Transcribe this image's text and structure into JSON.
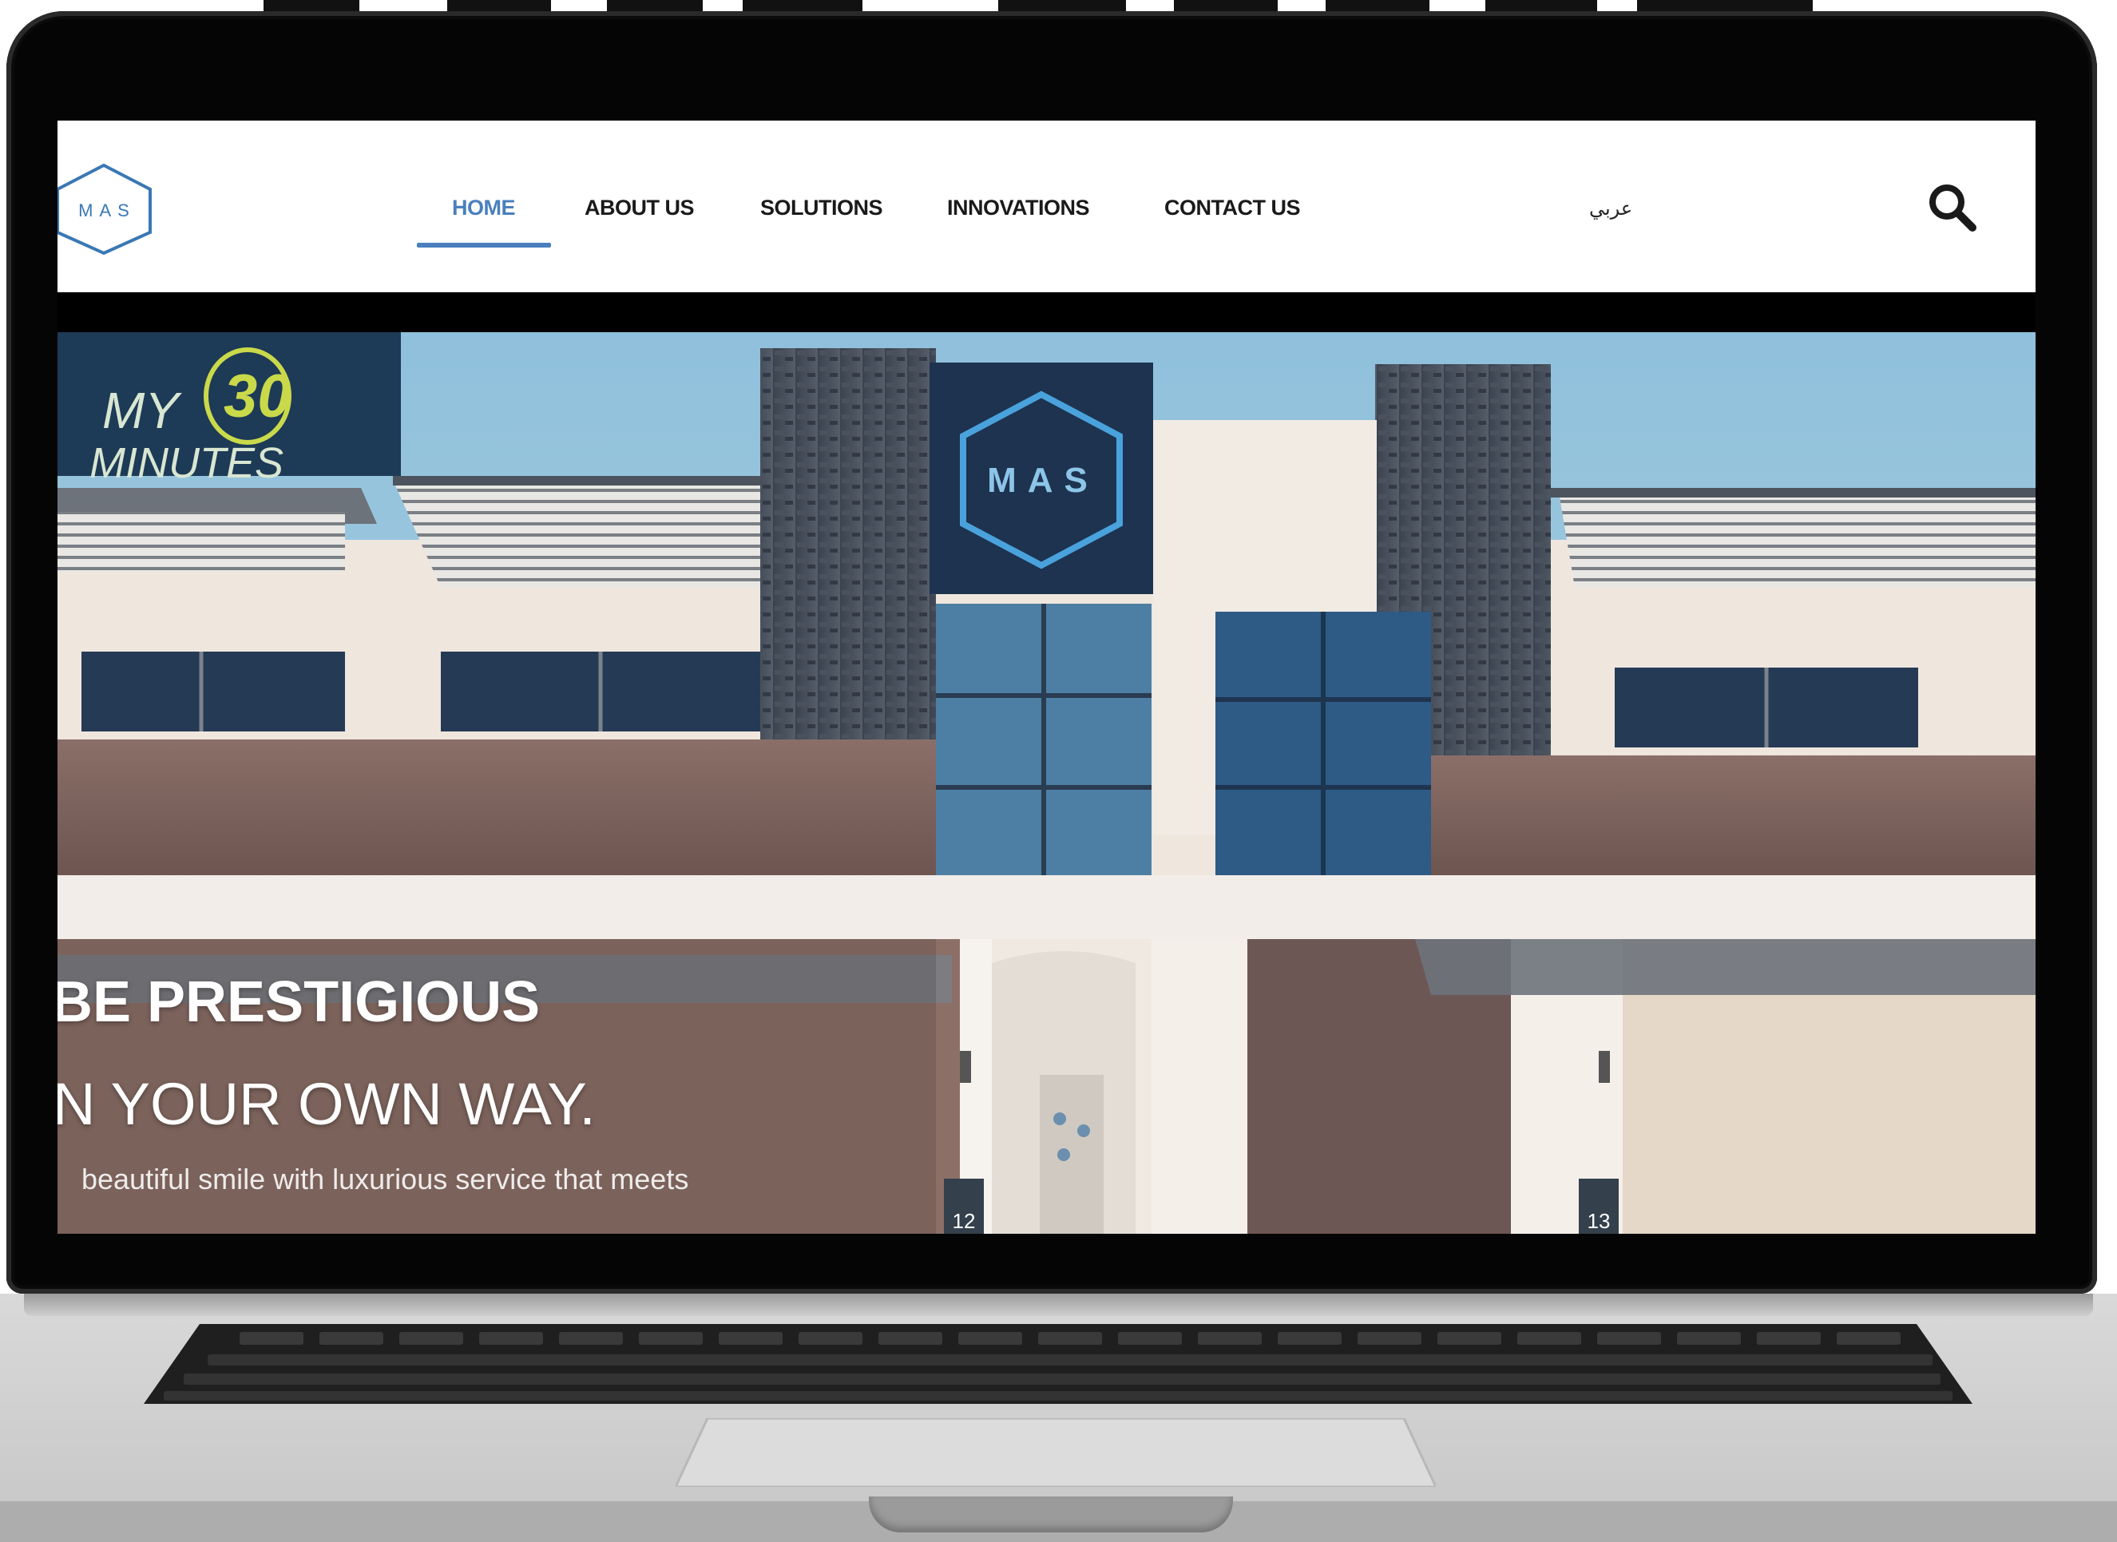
{
  "site": {
    "logo_text": "MAS",
    "brand_color": "#4a7fbd",
    "nav": [
      {
        "label": "HOME",
        "active": true
      },
      {
        "label": "ABOUT US",
        "active": false
      },
      {
        "label": "SOLUTIONS",
        "active": false
      },
      {
        "label": "INNOVATIONS",
        "active": false
      },
      {
        "label": "CONTACT US",
        "active": false
      }
    ],
    "language_link": "عربي",
    "search_icon": "search-icon"
  },
  "hero": {
    "headline_1": "BE PRESTIGIOUS",
    "headline_2": "N YOUR OWN WAY.",
    "subtext": "beautiful smile with luxurious service that meets",
    "building_sign_logo": "MAS",
    "billboard_text_1": "MY",
    "billboard_number": "30",
    "billboard_text_2": "MINUTES",
    "unit_numbers": [
      "12",
      "13"
    ]
  }
}
